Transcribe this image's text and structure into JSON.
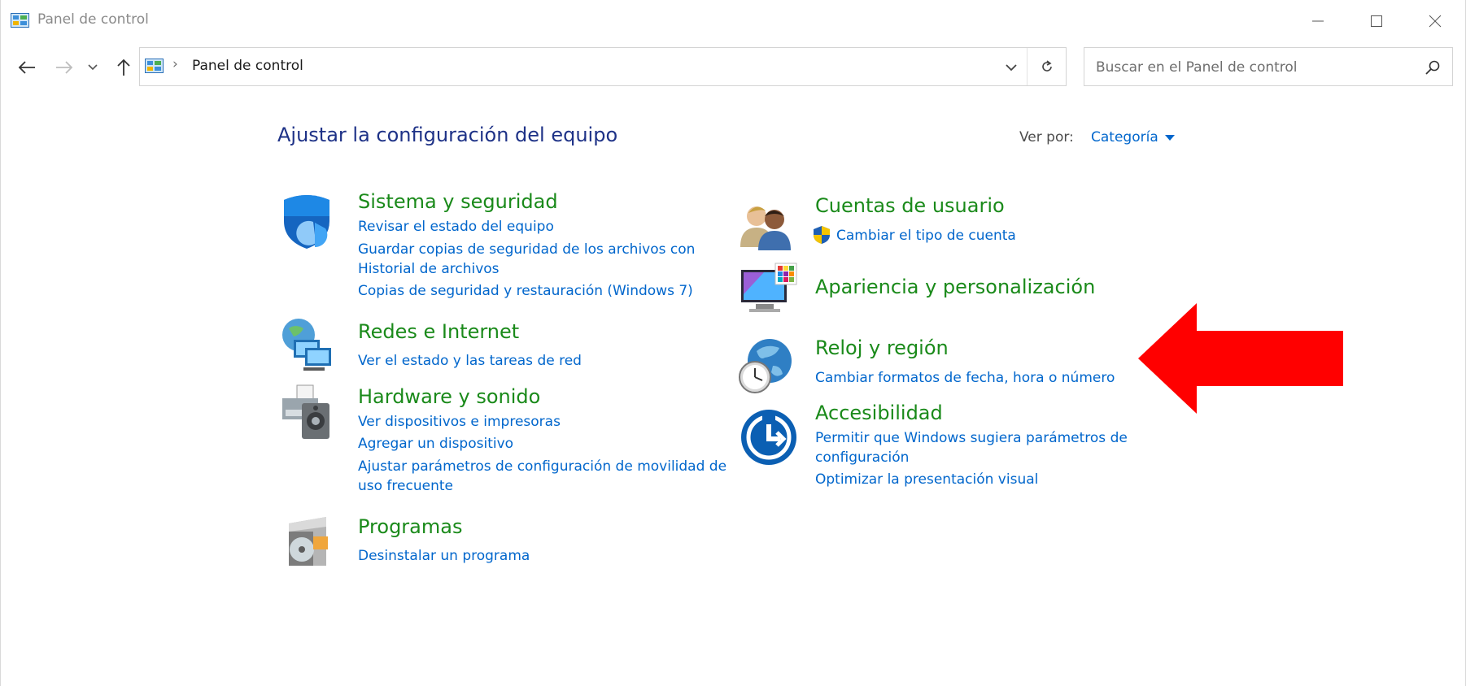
{
  "window": {
    "title": "Panel de control"
  },
  "colors": {
    "title": "#1e3287",
    "category": "#1a8a1a",
    "link": "#0066cc",
    "arrow": "#ff0000"
  },
  "address": {
    "path_label": "Panel de control"
  },
  "search": {
    "placeholder": "Buscar en el Panel de control"
  },
  "page": {
    "heading": "Ajustar la configuración del equipo",
    "view_by_label": "Ver por:",
    "view_by_value": "Categoría"
  },
  "categories": [
    {
      "title": "Sistema y seguridad",
      "icon": "shield-icon",
      "links": [
        "Revisar el estado del equipo",
        "Guardar copias de seguridad de los archivos con Historial de archivos",
        "Copias de seguridad y restauración (Windows 7)"
      ]
    },
    {
      "title": "Redes e Internet",
      "icon": "network-icon",
      "links": [
        "Ver el estado y las tareas de red"
      ]
    },
    {
      "title": "Hardware y sonido",
      "icon": "printer-speaker-icon",
      "links": [
        "Ver dispositivos e impresoras",
        "Agregar un dispositivo",
        "Ajustar parámetros de configuración de movilidad de uso frecuente"
      ]
    },
    {
      "title": "Programas",
      "icon": "programs-icon",
      "links": [
        "Desinstalar un programa"
      ]
    },
    {
      "title": "Cuentas de usuario",
      "icon": "users-icon",
      "links": [
        "Cambiar el tipo de cuenta"
      ]
    },
    {
      "title": "Apariencia y personalización",
      "icon": "monitor-palette-icon",
      "links": []
    },
    {
      "title": "Reloj y región",
      "icon": "globe-clock-icon",
      "links": [
        "Cambiar formatos de fecha, hora o número"
      ]
    },
    {
      "title": "Accesibilidad",
      "icon": "accessibility-icon",
      "links": [
        "Permitir que Windows sugiera parámetros de configuración",
        "Optimizar la presentación visual"
      ]
    }
  ]
}
